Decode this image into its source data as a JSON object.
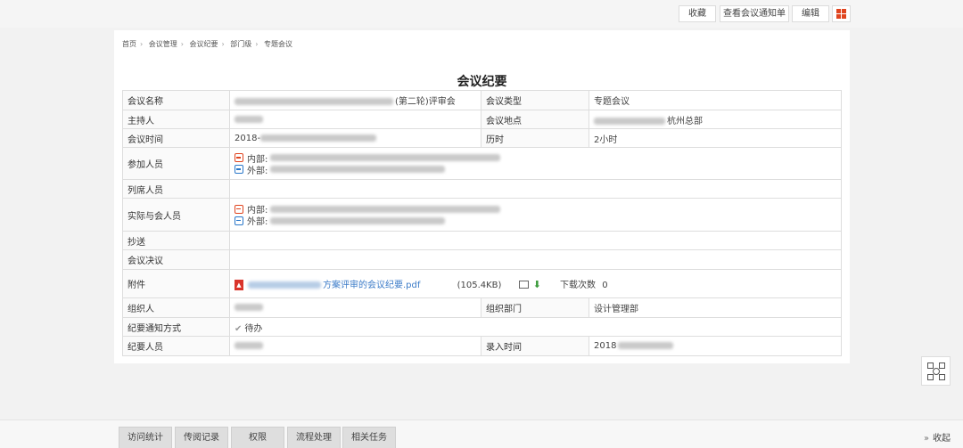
{
  "toolbar": {
    "favorite_label": "收藏",
    "view_notice_label": "查看会议通知单",
    "edit_label": "编辑",
    "accent_color": "#e0441f"
  },
  "breadcrumb": [
    "首页",
    "会议管理",
    "会议纪要",
    "部门级",
    "专题会议"
  ],
  "page_title": "会议纪要",
  "table": {
    "meeting_name_label": "会议名称",
    "meeting_name_suffix": "(第二轮)评审会",
    "meeting_type_label": "会议类型",
    "meeting_type_value": "专题会议",
    "host_label": "主持人",
    "location_label": "会议地点",
    "location_value": "杭州总部",
    "time_label": "会议时间",
    "time_value_prefix": "2018-",
    "duration_label": "历时",
    "duration_value": "2小时",
    "participants_label": "参加人员",
    "internal_label": "内部:",
    "external_label": "外部:",
    "attendees_label": "列席人员",
    "actual_label": "实际与会人员",
    "cc_label": "抄送",
    "resolution_label": "会议决议",
    "attachment_label": "附件",
    "attachment_name_suffix": "方案评审的会议纪要.pdf",
    "attachment_size": "(105.4KB)",
    "download_count_label": "下载次数",
    "download_count": "0",
    "pdf_icon": "pdf-icon",
    "organizer_label": "组织人",
    "org_dept_label": "组织部门",
    "org_dept_value": "设计管理部",
    "notify_method_label": "纪要通知方式",
    "notify_method_value": "待办",
    "recorder_label": "纪要人员",
    "entry_time_label": "录入时间",
    "entry_time_prefix": "2018"
  },
  "bottom_tabs": [
    "访问统计",
    "传阅记录",
    "权限",
    "流程处理",
    "相关任务"
  ],
  "collapse_label": "收起"
}
